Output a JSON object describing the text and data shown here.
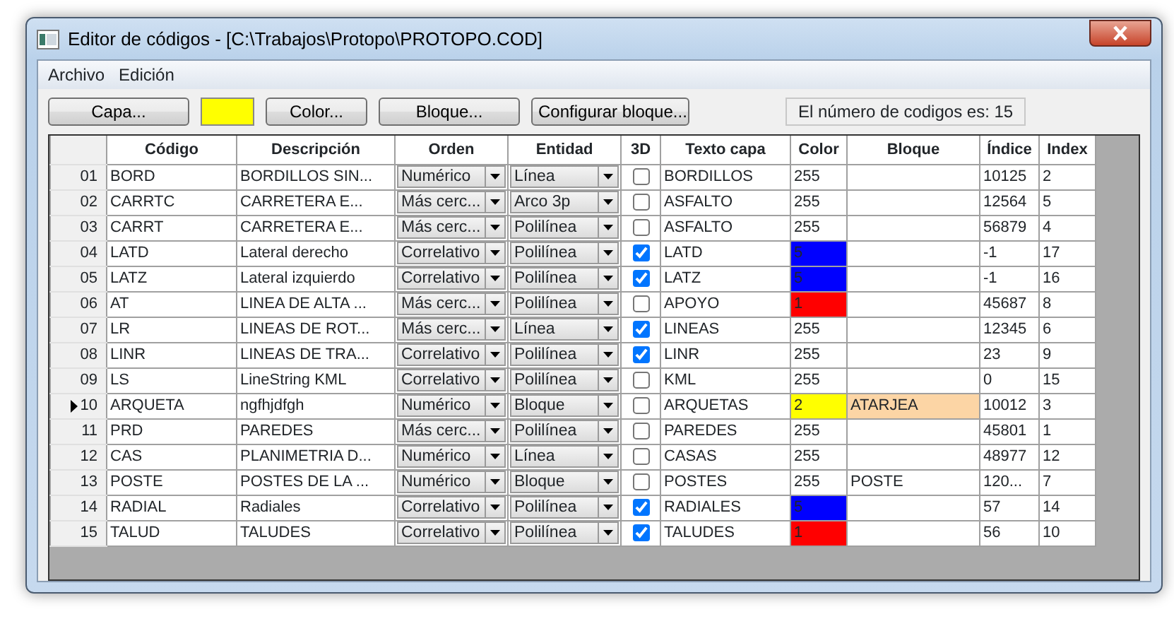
{
  "window": {
    "title": "Editor de códigos - [C:\\Trabajos\\Protopo\\PROTOPO.COD]"
  },
  "menu": [
    "Archivo",
    "Edición"
  ],
  "toolbar": {
    "buttons": [
      "Capa...",
      "Color...",
      "Bloque...",
      "Configurar bloque..."
    ],
    "color": "#ffff00",
    "status": "El número de codigos es: 15"
  },
  "table": {
    "columns": [
      "Código",
      "Descripción",
      "Orden",
      "Entidad",
      "3D",
      "Texto capa",
      "Color",
      "Bloque",
      "Índice",
      "Index"
    ],
    "rows": [
      {
        "number": "01",
        "codigo": "BORD",
        "descripcion": "BORDILLOS SIN...",
        "orden": "Numérico",
        "entidad": "Línea",
        "three_d": false,
        "texto_capa": "BORDILLOS",
        "color_value": "255",
        "bloque": "",
        "indice": "10125",
        "index": "2",
        "current": false
      },
      {
        "number": "02",
        "codigo": "CARRTC",
        "descripcion": "CARRETERA E...",
        "orden": "Más cerc...",
        "entidad": "Arco 3p",
        "three_d": false,
        "texto_capa": "ASFALTO",
        "color_value": "255",
        "bloque": "",
        "indice": "12564",
        "index": "5",
        "current": false
      },
      {
        "number": "03",
        "codigo": "CARRT",
        "descripcion": "CARRETERA E...",
        "orden": "Más cerc...",
        "entidad": "Polilínea",
        "three_d": false,
        "texto_capa": "ASFALTO",
        "color_value": "255",
        "bloque": "",
        "indice": "56879",
        "index": "4",
        "current": false
      },
      {
        "number": "04",
        "codigo": "LATD",
        "descripcion": "Lateral derecho",
        "orden": "Correlativo",
        "entidad": "Polilínea",
        "three_d": true,
        "texto_capa": "LATD",
        "color_value": "5",
        "color": "#0000ff",
        "bloque": "",
        "indice": "-1",
        "index": "17",
        "current": false
      },
      {
        "number": "05",
        "codigo": "LATZ",
        "descripcion": "Lateral izquierdo",
        "orden": "Correlativo",
        "entidad": "Polilínea",
        "three_d": true,
        "texto_capa": "LATZ",
        "color_value": "5",
        "color": "#0000ff",
        "bloque": "",
        "indice": "-1",
        "index": "16",
        "current": false
      },
      {
        "number": "06",
        "codigo": "AT",
        "descripcion": "LINEA DE ALTA ...",
        "orden": "Más cerc...",
        "entidad": "Polilínea",
        "three_d": false,
        "texto_capa": "APOYO",
        "color_value": "1",
        "color": "#ff0000",
        "bloque": "",
        "indice": "45687",
        "index": "8",
        "current": false
      },
      {
        "number": "07",
        "codigo": "LR",
        "descripcion": "LINEAS DE ROT...",
        "orden": "Más cerc...",
        "entidad": "Línea",
        "three_d": true,
        "texto_capa": "LINEAS",
        "color_value": "255",
        "bloque": "",
        "indice": "12345",
        "index": "6",
        "current": false
      },
      {
        "number": "08",
        "codigo": "LINR",
        "descripcion": "LINEAS DE TRA...",
        "orden": "Correlativo",
        "entidad": "Polilínea",
        "three_d": true,
        "texto_capa": "LINR",
        "color_value": "255",
        "bloque": "",
        "indice": "23",
        "index": "9",
        "current": false
      },
      {
        "number": "09",
        "codigo": "LS",
        "descripcion": "LineString KML",
        "orden": "Correlativo",
        "entidad": "Polilínea",
        "three_d": false,
        "texto_capa": "KML",
        "color_value": "255",
        "bloque": "",
        "indice": "0",
        "index": "15",
        "current": false
      },
      {
        "number": "10",
        "codigo": "ARQUETA",
        "descripcion": "ngfhjdfgh",
        "orden": "Numérico",
        "entidad": "Bloque",
        "three_d": false,
        "texto_capa": "ARQUETAS",
        "color_value": "2",
        "color": "#ffff00",
        "bloque": "ATARJEA",
        "indice": "10012",
        "index": "3",
        "current": true
      },
      {
        "number": "11",
        "codigo": "PRD",
        "descripcion": "PAREDES",
        "orden": "Más cerc...",
        "entidad": "Polilínea",
        "three_d": false,
        "texto_capa": "PAREDES",
        "color_value": "255",
        "bloque": "",
        "indice": "45801",
        "index": "1",
        "current": false
      },
      {
        "number": "12",
        "codigo": "CAS",
        "descripcion": "PLANIMETRIA D...",
        "orden": "Numérico",
        "entidad": "Línea",
        "three_d": false,
        "texto_capa": "CASAS",
        "color_value": "255",
        "bloque": "",
        "indice": "48977",
        "index": "12",
        "current": false
      },
      {
        "number": "13",
        "codigo": "POSTE",
        "descripcion": "POSTES DE LA ...",
        "orden": "Numérico",
        "entidad": "Bloque",
        "three_d": false,
        "texto_capa": "POSTES",
        "color_value": "255",
        "bloque": "POSTE",
        "indice": "120...",
        "index": "7",
        "current": false
      },
      {
        "number": "14",
        "codigo": "RADIAL",
        "descripcion": "Radiales",
        "orden": "Correlativo",
        "entidad": "Polilínea",
        "three_d": true,
        "texto_capa": "RADIALES",
        "color_value": "5",
        "color": "#0000ff",
        "bloque": "",
        "indice": "57",
        "index": "14",
        "current": false
      },
      {
        "number": "15",
        "codigo": "TALUD",
        "descripcion": "TALUDES",
        "orden": "Correlativo",
        "entidad": "Polilínea",
        "three_d": true,
        "texto_capa": "TALUDES",
        "color_value": "1",
        "color": "#ff0000",
        "bloque": "",
        "indice": "56",
        "index": "10",
        "current": false
      }
    ]
  }
}
